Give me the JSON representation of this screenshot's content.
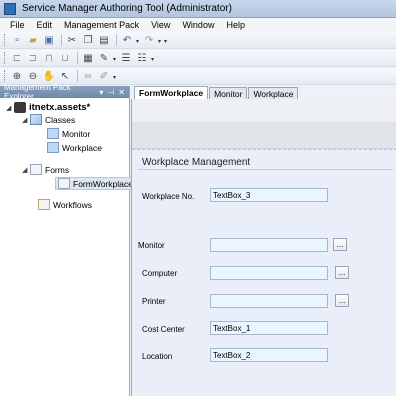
{
  "window": {
    "title": "Service Manager Authoring Tool (Administrator)"
  },
  "menu": [
    "File",
    "Edit",
    "Management Pack",
    "View",
    "Window",
    "Help"
  ],
  "explorer": {
    "title": "Management Pack Explorer",
    "root": "itnetx.assets*",
    "classes_label": "Classes",
    "classes": [
      "Monitor",
      "Workplace"
    ],
    "forms_label": "Forms",
    "forms": [
      "FormWorkplace"
    ],
    "workflows_label": "Workflows"
  },
  "tabs": [
    "FormWorkplace",
    "Monitor",
    "Workplace"
  ],
  "form": {
    "title": "Workplace Management",
    "fields": {
      "workplace_no": {
        "label": "Workplace No.",
        "value": "TextBox_3"
      },
      "monitor": {
        "label": "Monitor",
        "value": ""
      },
      "computer": {
        "label": "Computer",
        "value": ""
      },
      "printer": {
        "label": "Printer",
        "value": ""
      },
      "cost_center": {
        "label": "Cost Center",
        "value": "TextBox_1"
      },
      "location": {
        "label": "Location",
        "value": "TextBox_2"
      }
    },
    "ellipsis": "..."
  }
}
